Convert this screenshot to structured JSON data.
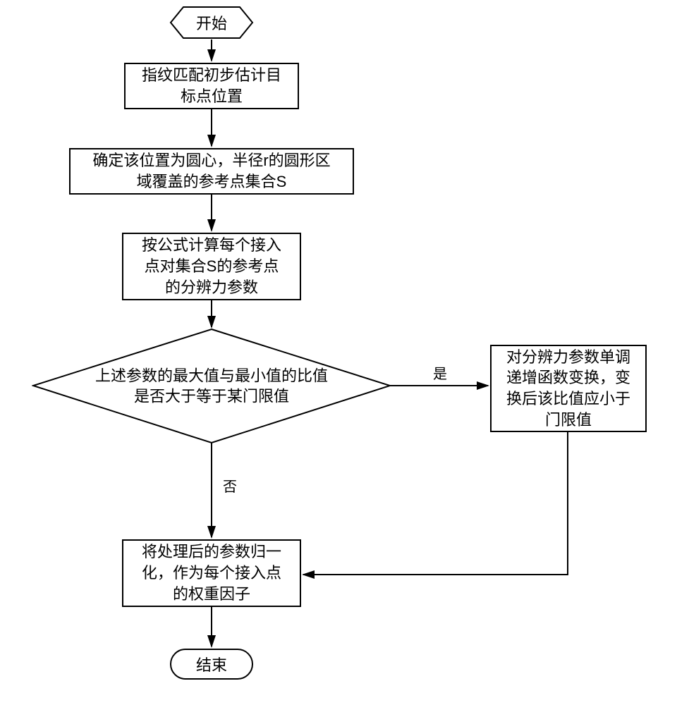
{
  "flow": {
    "start": "开始",
    "step1": "指纹匹配初步估计目\n标点位置",
    "step2": "确定该位置为圆心，半径r的圆形区\n域覆盖的参考点集合S",
    "step3": "按公式计算每个接入\n点对集合S的参考点\n的分辨力参数",
    "decision": "上述参数的最大值与最小值的比值\n是否大于等于某门限值",
    "yes_label": "是",
    "no_label": "否",
    "step_yes": "对分辨力参数单调\n递增函数变换，变\n换后该比值应小于\n门限值",
    "step_final": "将处理后的参数归一\n化，作为每个接入点\n的权重因子",
    "end": "结束"
  }
}
